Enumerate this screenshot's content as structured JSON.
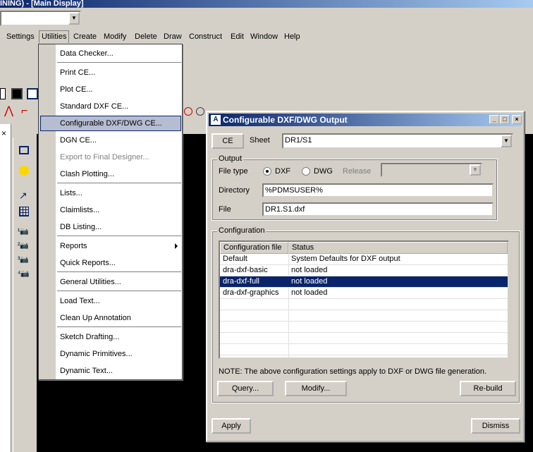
{
  "app": {
    "title": "INING) - [Main Display]",
    "menubar": [
      "Settings",
      "Utilities",
      "Create",
      "Modify",
      "Delete",
      "Draw",
      "Construct",
      "Edit",
      "Window",
      "Help"
    ]
  },
  "utilities_menu": {
    "items": [
      {
        "label": "Data Checker...",
        "enabled": true
      },
      {
        "label": "Print CE...",
        "enabled": true
      },
      {
        "label": "Plot CE...",
        "enabled": true
      },
      {
        "label": "Standard DXF CE...",
        "enabled": true
      },
      {
        "label": "Configurable DXF/DWG CE...",
        "enabled": true,
        "highlighted": true
      },
      {
        "label": "DGN  CE...",
        "enabled": true
      },
      {
        "label": "Export to Final Designer...",
        "enabled": false
      },
      {
        "label": "Clash Plotting...",
        "enabled": true
      },
      {
        "label": "Lists...",
        "enabled": true
      },
      {
        "label": "Claimlists...",
        "enabled": true
      },
      {
        "label": "DB Listing...",
        "enabled": true
      },
      {
        "label": "Reports",
        "enabled": true,
        "submenu": true
      },
      {
        "label": "Quick Reports...",
        "enabled": true
      },
      {
        "label": "General Utilities...",
        "enabled": true
      },
      {
        "label": "Load Text...",
        "enabled": true
      },
      {
        "label": "Clean Up Annotation",
        "enabled": true
      },
      {
        "label": "Sketch Drafting...",
        "enabled": true
      },
      {
        "label": "Dynamic Primitives...",
        "enabled": true
      },
      {
        "label": "Dynamic Text...",
        "enabled": true
      }
    ]
  },
  "dialog": {
    "title": "Configurable DXF/DWG Output",
    "title_icon": "A",
    "ce_button": "CE",
    "sheet_label": "Sheet",
    "sheet_value": "DR1/S1",
    "output": {
      "group_label": "Output",
      "file_type_label": "File type",
      "dxf_label": "DXF",
      "dwg_label": "DWG",
      "selected": "DXF",
      "release_label": "Release",
      "release_value": "",
      "directory_label": "Directory",
      "directory_value": "%PDMSUSER%",
      "file_label": "File",
      "file_value": "DR1.S1.dxf"
    },
    "configuration": {
      "group_label": "Configuration",
      "columns": [
        "Configuration file",
        "Status"
      ],
      "rows": [
        {
          "file": "Default",
          "status": "System Defaults for DXF output",
          "selected": false
        },
        {
          "file": "dra-dxf-basic",
          "status": "not loaded",
          "selected": false
        },
        {
          "file": "dra-dxf-full",
          "status": "not loaded",
          "selected": true
        },
        {
          "file": "dra-dxf-graphics",
          "status": "not loaded",
          "selected": false
        }
      ],
      "note": "NOTE: The above configuration settings apply to DXF or DWG file generation.",
      "query_button": "Query...",
      "modify_button": "Modify...",
      "rebuild_button": "Re-build"
    },
    "apply_button": "Apply",
    "dismiss_button": "Dismiss"
  }
}
